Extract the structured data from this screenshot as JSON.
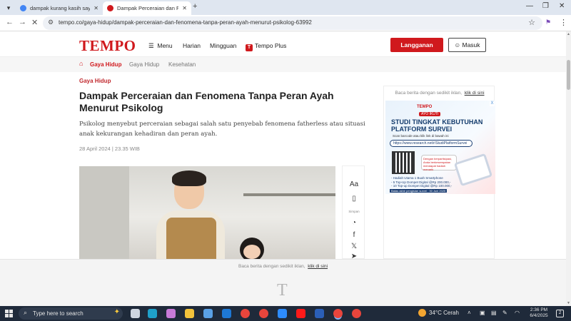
{
  "browser": {
    "tabs": [
      {
        "title": "dampak kurang kasih sayang pa",
        "favicon_color": "#4285f4"
      },
      {
        "title": "Dampak Perceraian dan Fenome",
        "favicon_color": "#d0191d"
      }
    ],
    "new_tab": "+",
    "window_controls": {
      "minimize": "—",
      "maximize": "❐",
      "close": "✕"
    },
    "url": "tempo.co/gaya-hidup/dampak-perceraian-dan-fenomena-tanpa-peran-ayah-menurut-psikolog-63992"
  },
  "site": {
    "logo": "TEMPO",
    "nav": {
      "menu": "Menu",
      "harian": "Harian",
      "mingguan": "Mingguan",
      "tempo_plus_badge": "T",
      "tempo_plus": "Tempo Plus"
    },
    "subscribe": "Langganan",
    "login": "Masuk",
    "subnav": {
      "home_label": "Gaya Hidup",
      "items": [
        "Gaya Hidup",
        "Kesehatan"
      ]
    }
  },
  "article": {
    "category": "Gaya Hidup",
    "title": "Dampak Perceraian dan Fenomena Tanpa Peran Ayah Menurut Psikolog",
    "lead": "Psikolog menyebut perceraian sebagai salah satu penyebab fenomena fatherless atau situasi anak kekurangan kehadiran dan peran ayah.",
    "date": "28 April 2024 | 23.35 WIB",
    "share_rail": {
      "font_size": "Aa",
      "save_caption": "Simpan"
    }
  },
  "sidebar_ad": {
    "note": "Baca berita dengan sedikit iklan,",
    "note_link": "klik di sini",
    "brand": "TEMPO",
    "badge": "AYO IKUTI",
    "headline": "STUDI TINGKAT KEBUTUHAN PLATFORM SURVEI",
    "scan_text": "Scan barcode atau klik link di bawah ini",
    "link": "https://www.research.net/r/StudiPlatformSurvei",
    "bubble": "Dengan berpartisipasi, Anda berkesempatan mendapat hadiah menarik",
    "prizes": [
      "- Hadiah Utama 1 Buah Smartphone",
      "- 5 Top-Up Dompet Digital @Rp 200.000,-",
      "- 10 Top-up Dompet Digital @Rp 100.000,-"
    ],
    "deadline": "Batas akhir pengisian survei : 30 Juni 2025",
    "ad_x": "X"
  },
  "bottom_ad": {
    "note": "Baca berita dengan sedikit iklan,",
    "note_link": "klik di sini",
    "mark": "T"
  },
  "taskbar": {
    "search_placeholder": "Type here to search",
    "weather": "34°C  Cerah",
    "time": "2:36 PM",
    "date": "6/4/2025",
    "notifications": "2",
    "apps": [
      {
        "name": "task-view",
        "color": "#cfd6e0"
      },
      {
        "name": "edge",
        "color": "#1fa0c9"
      },
      {
        "name": "copilot",
        "color": "#c77ad8"
      },
      {
        "name": "file-explorer",
        "color": "#f2c23b"
      },
      {
        "name": "store",
        "color": "#5aa1e6"
      },
      {
        "name": "outlook",
        "color": "#1e78d4"
      },
      {
        "name": "chrome-1",
        "color": "#e8453c"
      },
      {
        "name": "chrome-2",
        "color": "#e8453c"
      },
      {
        "name": "zoom",
        "color": "#2d8cff"
      },
      {
        "name": "youtube",
        "color": "#ff1a1a"
      },
      {
        "name": "word",
        "color": "#2b5fb8"
      },
      {
        "name": "chrome-active",
        "color": "#e8453c"
      },
      {
        "name": "chrome-3",
        "color": "#e8453c"
      }
    ]
  }
}
